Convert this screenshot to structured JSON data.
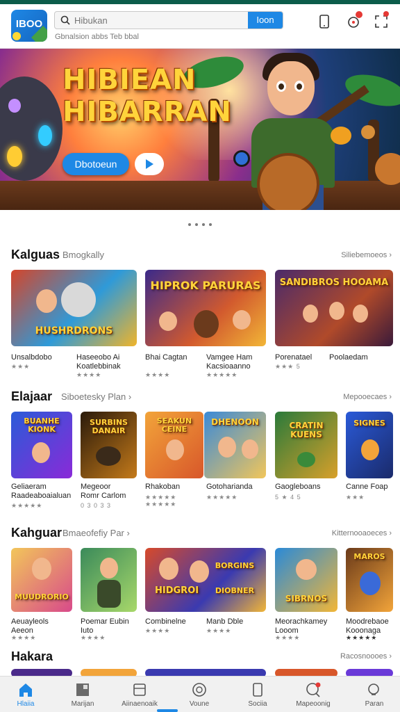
{
  "header": {
    "logo_text": "IBOO",
    "search_placeholder": "Hibukan",
    "search_button": "Ioon",
    "subcaption": "Gbnalsion abbs Teb bbal"
  },
  "hero": {
    "title_line1": "HIBIEAN",
    "title_line2": "HIBARRAN",
    "cta_label": "Dbotoeun",
    "page_dots": 4
  },
  "sections": [
    {
      "title": "Kalguas",
      "subtitle": "Bmogkally",
      "more": "Siliebemoeos",
      "games": [
        {
          "art": "HUSHRDRONS",
          "name": "Unsalbdobo",
          "stars": "★★★"
        },
        {
          "art": "HIPROK PARURAS",
          "name": "Haseeobo Ai\nKoatlebbinak",
          "stars": "★★★★"
        },
        {
          "art": "",
          "name": "Bhai Cagtan",
          "stars": "★★★★"
        },
        {
          "art": "",
          "name": "Vamgee Ham\nKacsioaanno",
          "stars": "★★★★★"
        },
        {
          "art": "SANDIBROS HOOAMA",
          "name": "Porenatael",
          "stars": "★★★ 5"
        },
        {
          "art": "",
          "name": "Poolaedam",
          "stars": ""
        }
      ]
    },
    {
      "title": "Elajaar",
      "subtitle": "Siboetesky  Plan",
      "more": "Mepooecaes",
      "games": [
        {
          "art": "BUANHE KIONK",
          "name": "Geliaeram\nRaadeaboaialuan",
          "stars": "★★★★★"
        },
        {
          "art": "SURBINS DANAIR",
          "name": "Megeoor\nRomr Carlom",
          "stars": "0 3 0 3 3"
        },
        {
          "art": "SEAKUN CEINE",
          "name": "Rhakoban",
          "stars": "★★★★★"
        },
        {
          "art": "DHENOON",
          "name": "Gotoharianda",
          "stars": "★★★★★"
        },
        {
          "art": "CRATIN KUENS",
          "name": "Gaogleboans",
          "stars": "5 ★ 4 5"
        },
        {
          "art": "SIGNES",
          "name": "Canne  Foap",
          "stars": "★★★"
        }
      ]
    },
    {
      "title": "Kahguar",
      "subtitle": "Bmaeofefiy  Par",
      "more": "Kitternooaoeces",
      "games": [
        {
          "art": "MUUDRORIO",
          "name": "Aeuayleols\nAeeon",
          "stars": "★★★★"
        },
        {
          "art": "",
          "name": "Poemar Eubin\nIuto",
          "stars": "★★★★"
        },
        {
          "art": "HIDGROI",
          "name": "Combinelne",
          "stars": "★★★★"
        },
        {
          "art": "BORGINS DIOBNER",
          "name": "Manb Dble",
          "stars": "★★★★"
        },
        {
          "art": "SIBRNOS",
          "name": "Meorachkamey\nLooom",
          "stars": "★★★★"
        },
        {
          "art": "MAROS",
          "name": "Moodrebaoe\nKooonaga",
          "stars": "★★★★★"
        }
      ]
    },
    {
      "title": "Hakara",
      "more": "Racosnoooes"
    }
  ],
  "nav": [
    {
      "label": "Hlaiia",
      "icon": "home-icon"
    },
    {
      "label": "Marijan",
      "icon": "grid-icon"
    },
    {
      "label": "Aiinaenoaik",
      "icon": "library-icon"
    },
    {
      "label": "Voune",
      "icon": "globe-icon"
    },
    {
      "label": "Sociia",
      "icon": "phone-icon"
    },
    {
      "label": "Mapeoonig",
      "icon": "chat-icon"
    },
    {
      "label": "Paran",
      "icon": "search-icon"
    }
  ]
}
